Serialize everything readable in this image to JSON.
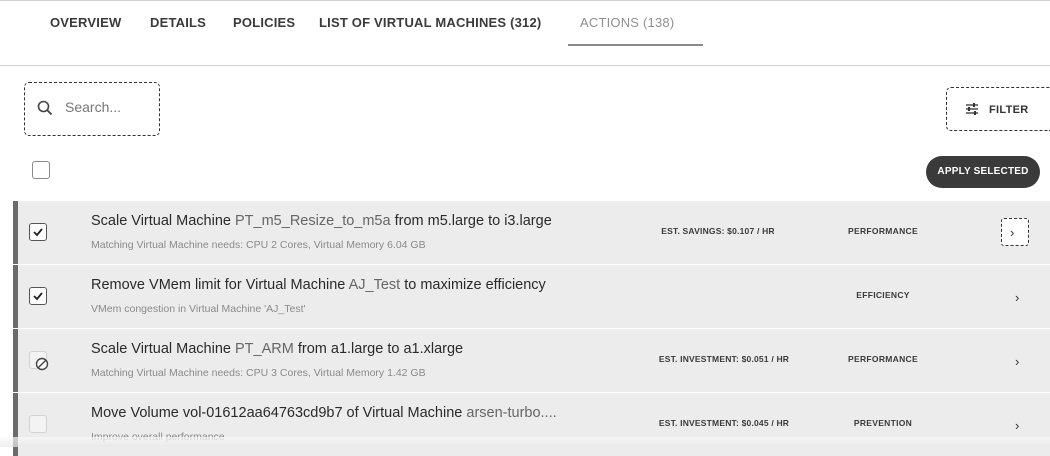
{
  "tabs": [
    {
      "label": "OVERVIEW"
    },
    {
      "label": "DETAILS"
    },
    {
      "label": "POLICIES"
    },
    {
      "label": "LIST OF VIRTUAL MACHINES (312)"
    },
    {
      "label": "ACTIONS (138)",
      "active": true
    }
  ],
  "search": {
    "placeholder": "Search...",
    "icon": "search-icon"
  },
  "filter": {
    "label": "FILTER",
    "icon": "sliders-icon"
  },
  "apply_selected_label": "APPLY SELECTED",
  "actions": [
    {
      "title_pre": "Scale Virtual Machine ",
      "entity": "PT_m5_Resize_to_m5a",
      "title_post": " from m5.large to i3.large",
      "subtitle": "Matching Virtual Machine needs: CPU 2 Cores, Virtual Memory 6.04 GB",
      "metric": "EST. SAVINGS: $0.107 / HR",
      "category": "PERFORMANCE",
      "checkbox": "checked"
    },
    {
      "title_pre": "Remove VMem limit for Virtual Machine ",
      "entity": "AJ_Test",
      "title_post": " to maximize efficiency",
      "subtitle": "VMem congestion in Virtual Machine 'AJ_Test'",
      "metric": "",
      "category": "EFFICIENCY",
      "checkbox": "checked"
    },
    {
      "title_pre": "Scale Virtual Machine ",
      "entity": "PT_ARM",
      "title_post": " from a1.large to a1.xlarge",
      "subtitle": "Matching Virtual Machine needs: CPU 3 Cores, Virtual Memory 1.42 GB",
      "metric": "EST. INVESTMENT: $0.051 / HR",
      "category": "PERFORMANCE",
      "checkbox": "disabled"
    },
    {
      "title_pre": "Move Volume vol-01612aa64763cd9b7 of Virtual Machine ",
      "entity": "arsen-turbo....",
      "title_post": "",
      "subtitle": "Improve overall performance",
      "metric": "EST. INVESTMENT: $0.045 / HR",
      "category": "PREVENTION",
      "checkbox": "disabled"
    }
  ]
}
